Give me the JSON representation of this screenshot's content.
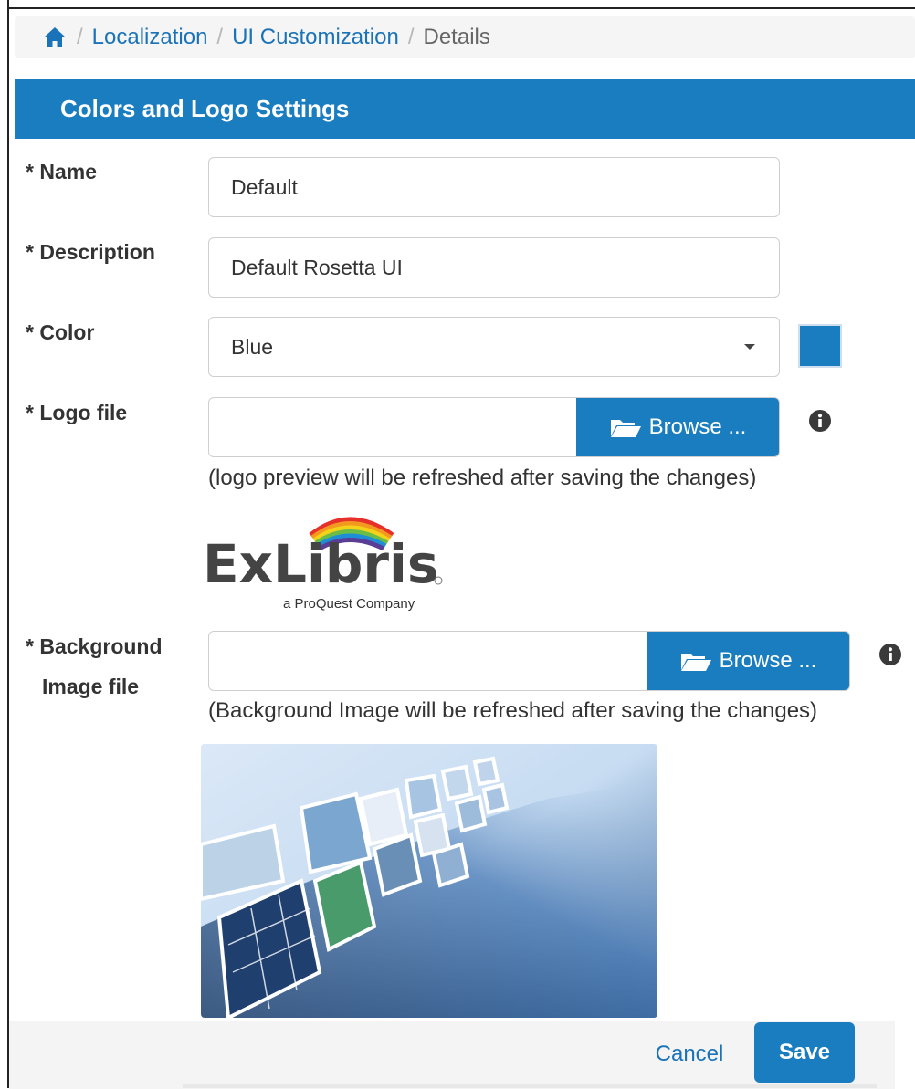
{
  "breadcrumb": {
    "items": [
      "Localization",
      "UI Customization"
    ],
    "current": "Details"
  },
  "panel": {
    "title": "Colors and Logo Settings"
  },
  "form": {
    "name": {
      "label": "* Name",
      "value": "Default"
    },
    "description": {
      "label": "* Description",
      "value": "Default Rosetta UI"
    },
    "color": {
      "label": "* Color",
      "value": "Blue",
      "swatch": "#1a7dbf"
    },
    "logo": {
      "label": "* Logo file",
      "browse_label": "Browse ...",
      "hint": "(logo preview will be refreshed after saving the changes)",
      "logo_text": "ExLibris",
      "logo_sub": "a ProQuest Company"
    },
    "background": {
      "label_line1": "* Background",
      "label_line2": "Image file",
      "browse_label": "Browse ...",
      "hint": "(Background Image will be refreshed after saving the changes)"
    }
  },
  "footer": {
    "cancel_label": "Cancel",
    "save_label": "Save"
  },
  "colors": {
    "primary": "#1a7dbf",
    "link": "#1a73b8"
  },
  "icons": [
    "home-icon",
    "folder-open-icon",
    "info-icon",
    "chevron-down-icon"
  ]
}
